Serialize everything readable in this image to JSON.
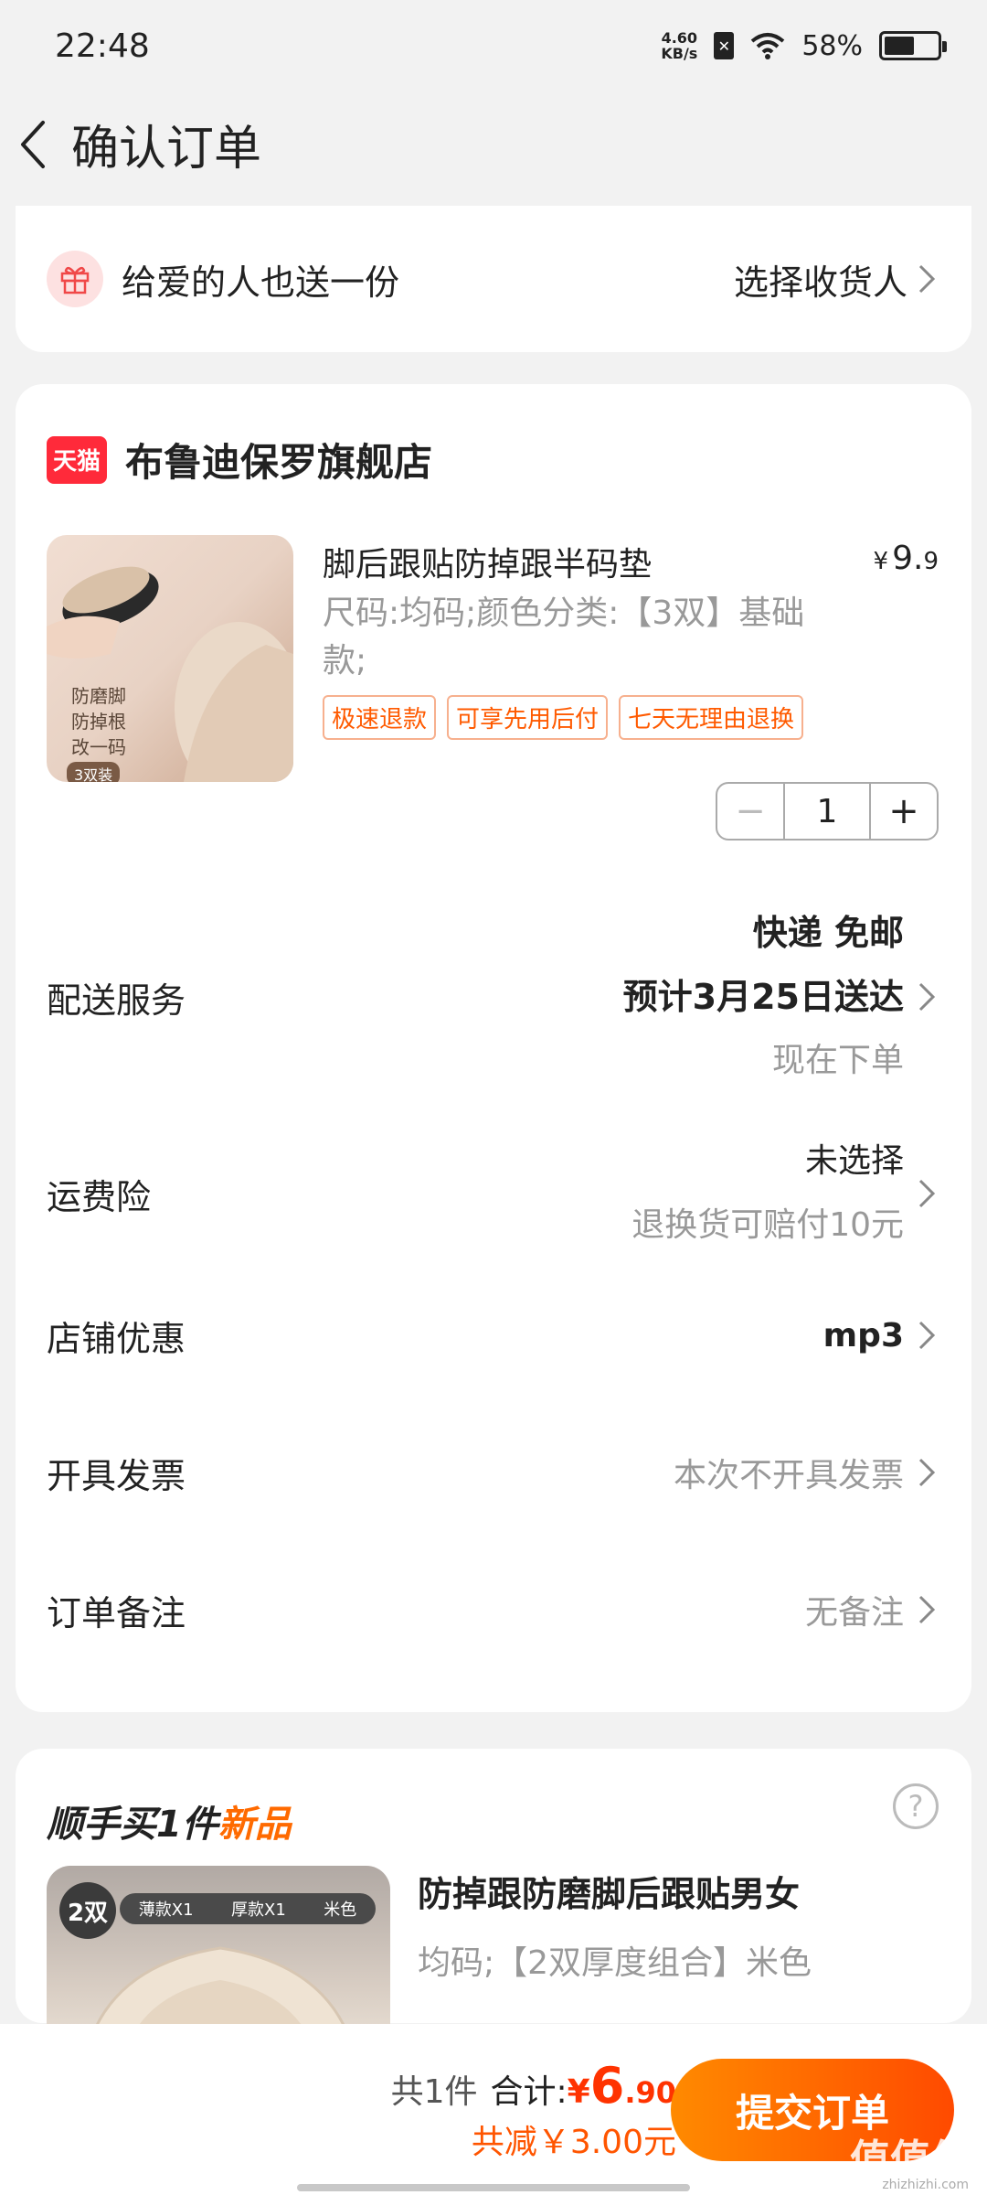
{
  "status_bar": {
    "time": "22:48",
    "net_speed_value": "4.60",
    "net_speed_unit": "KB/s",
    "battery": "58%",
    "battery_level": 0.58
  },
  "nav": {
    "title": "确认订单"
  },
  "gift": {
    "text": "给爱的人也送一份",
    "action": "选择收货人"
  },
  "store": {
    "badge": "天猫",
    "name": "布鲁迪保罗旗舰店"
  },
  "product": {
    "title": "脚后跟贴防掉跟半码垫",
    "price_currency": "¥",
    "price_int": "9.",
    "price_dec": "9",
    "spec": "尺码:均码;颜色分类:【3双】基础款;",
    "image_text_1": "防磨脚",
    "image_text_2": "防掉根",
    "image_text_3": "改一码",
    "image_pack": "3双装",
    "tags": [
      "极速退款",
      "可享先用后付",
      "七天无理由退换"
    ],
    "quantity": "1",
    "minus": "−",
    "plus": "+"
  },
  "rows": {
    "delivery_label": "配送服务",
    "delivery_line1": "快递 免邮",
    "delivery_line2": "预计3月25日送达",
    "delivery_line3": "现在下单",
    "insurance_label": "运费险",
    "insurance_line1": "未选择",
    "insurance_line2": "退换货可赔付10元",
    "discount_label": "店铺优惠",
    "discount_value": "mp3",
    "invoice_label": "开具发票",
    "invoice_value": "本次不开具发票",
    "note_label": "订单备注",
    "note_value": "无备注"
  },
  "recommend": {
    "title_prefix": "顺手买1件",
    "title_highlight": "新品",
    "help": "?",
    "image_badge": "2双",
    "image_strip_1": "薄款X1",
    "image_strip_2": "厚款X1",
    "image_strip_3": "米色",
    "name": "防掉跟防磨脚后跟贴男女",
    "spec": "均码;【2双厚度组合】米色"
  },
  "bottom": {
    "count": "共1件",
    "total_label": "合计:",
    "total_currency": "¥",
    "total_int": "6",
    "total_dec": ".90",
    "saved": "共减￥3.00元",
    "submit": "提交订单",
    "watermark": "值值值",
    "watermark_sub": "zhizhizhi.com"
  },
  "colors": {
    "accent": "#ff5a00",
    "price_red": "#ff3300",
    "tmall_red": "#ff2a3a"
  }
}
